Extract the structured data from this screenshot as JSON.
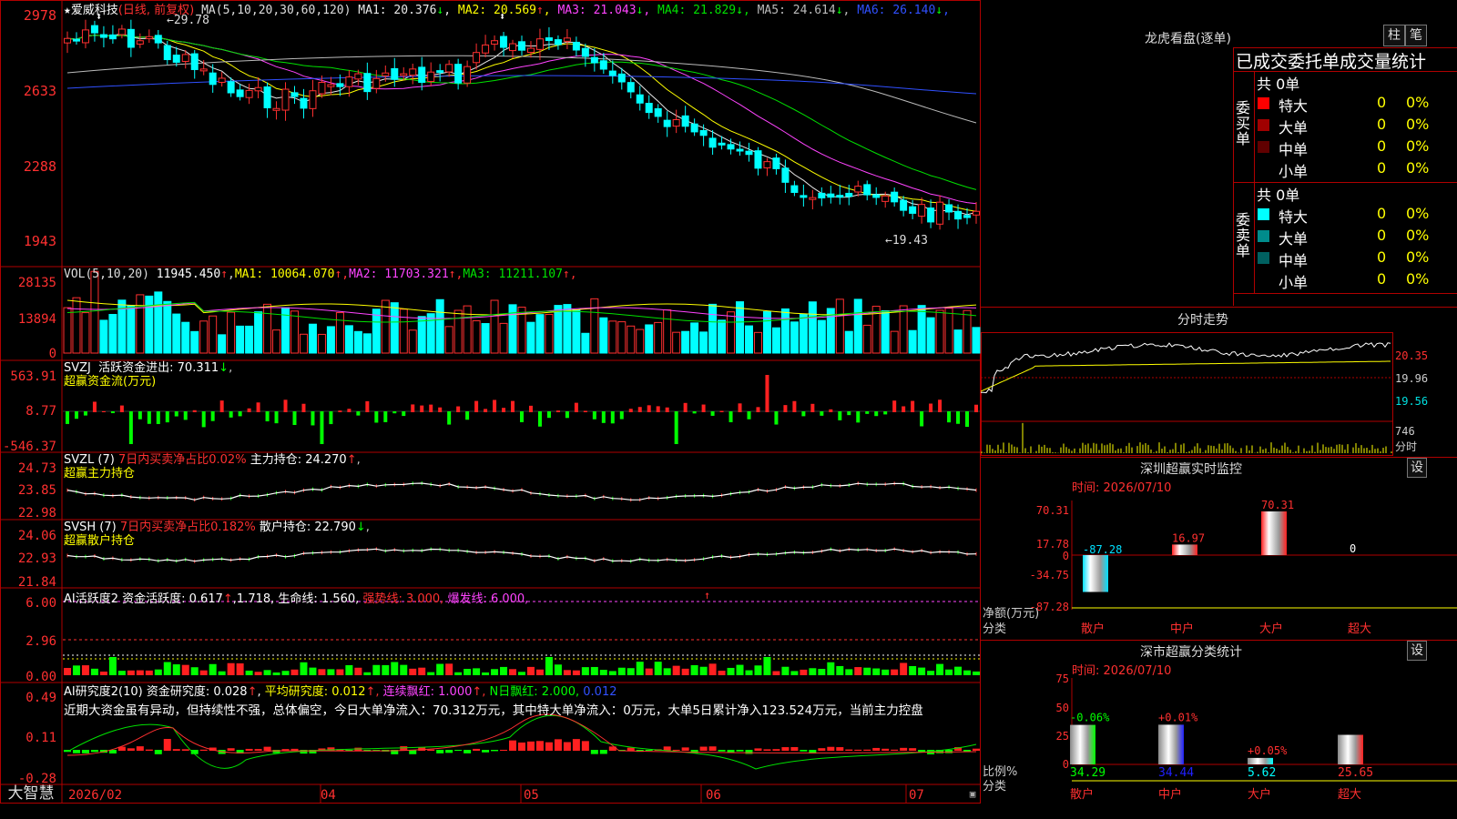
{
  "app": {
    "name": "大智慧",
    "logo": "大智慧"
  },
  "chart_header": {
    "stock": "爱威科技",
    "period": "(日线, 前复权)",
    "ma_params": "MA(5,10,20,30,60,120)",
    "ma": [
      {
        "label": "MA1:",
        "value": "20.376",
        "arrow": "↓",
        "color": "#e8e8e8"
      },
      {
        "label": "MA2:",
        "value": "20.569",
        "arrow": "↑",
        "color": "#ffff00"
      },
      {
        "label": "MA3:",
        "value": "21.043",
        "arrow": "↓",
        "color": "#ff44ff"
      },
      {
        "label": "MA4:",
        "value": "21.829",
        "arrow": "↓",
        "color": "#00e000"
      },
      {
        "label": "MA5:",
        "value": "24.614",
        "arrow": "↓",
        "color": "#bbbbbb"
      },
      {
        "label": "MA6:",
        "value": "26.140",
        "arrow": "↓",
        "color": "#3050ff"
      }
    ],
    "high_mark": "29.78",
    "low_mark": "19.43"
  },
  "price_axis": [
    "2978",
    "2633",
    "2288",
    "1943"
  ],
  "volume": {
    "header": "VOL(5,10,20)",
    "value": "11945.450",
    "value_arrow": "↑",
    "ma": [
      {
        "label": "MA1:",
        "value": "10064.070",
        "arrow": "↑",
        "color": "#ffff00"
      },
      {
        "label": "MA2:",
        "value": "11703.321",
        "arrow": "↑",
        "color": "#ff44ff"
      },
      {
        "label": "MA3:",
        "value": "11211.107",
        "arrow": "↑",
        "color": "#00e000"
      }
    ],
    "axis": [
      "28135",
      "13894",
      "0"
    ]
  },
  "svzj": {
    "line1": "SVZJ  活跃资金进出: 70.311",
    "arrow": "↓",
    "line2": "超赢资金流(万元)",
    "axis": [
      "563.91",
      "8.77",
      "-546.37"
    ]
  },
  "svzl": {
    "name": "SVZL (7)",
    "desc": "7日内买卖净占比0.02%",
    "label": "主力持仓: 24.270",
    "arrow": "↑",
    "line2": "超赢主力持仓",
    "axis": [
      "24.73",
      "23.85",
      "22.98"
    ]
  },
  "svsh": {
    "name": "SVSH (7)",
    "desc": "7日内买卖净占比0.182%",
    "label": "散户持仓: 22.790",
    "arrow": "↓",
    "line2": "超赢散户持仓",
    "axis": [
      "24.06",
      "22.93",
      "21.84"
    ]
  },
  "ai_active": {
    "name": "AI活跃度2",
    "label": "资金活跃度: 0.617",
    "arrow": "↑",
    "v2": "1.718,",
    "life": "生命线: 1.560,",
    "strong": "强势线: 3.000,",
    "burst": "爆发线: 6.000,",
    "axis": [
      "6.00",
      "2.96",
      "0.00"
    ]
  },
  "ai_research": {
    "name": "AI研究度2(10)",
    "label": "资金研究度: 0.028",
    "arrow": "↑",
    "avg": "平均研究度: 0.012",
    "cont": "连续飘红: 1.000",
    "nday": "N日飘红: 2.000,",
    "last": "0.012",
    "comment": "近期大资金虽有异动，但持续性不强，总体偏空，今日大单净流入：70.312万元，其中特大单净流入：0万元，大单5日累计净入123.524万元，当前主力控盘",
    "axis": [
      "0.49",
      "0.11",
      "-0.28"
    ]
  },
  "xaxis": [
    "2026/02",
    "04",
    "05",
    "06",
    "07"
  ],
  "dragon": {
    "title": "龙虎看盘(逐单)",
    "btn_bar": "柱",
    "btn_pen": "笔",
    "subtitle": "已成交委托单成交量统计",
    "buy": {
      "side": "委买单",
      "total": "共 0单",
      "rows": [
        {
          "label": "特大",
          "count": "0",
          "pct": "0%",
          "color": "#ff0000"
        },
        {
          "label": "大单",
          "count": "0",
          "pct": "0%",
          "color": "#a00000"
        },
        {
          "label": "中单",
          "count": "0",
          "pct": "0%",
          "color": "#600000"
        },
        {
          "label": "小单",
          "count": "0",
          "pct": "0%",
          "color": "#000000"
        }
      ]
    },
    "sell": {
      "side": "委卖单",
      "total": "共 0单",
      "rows": [
        {
          "label": "特大",
          "count": "0",
          "pct": "0%",
          "color": "#00ffff"
        },
        {
          "label": "大单",
          "count": "0",
          "pct": "0%",
          "color": "#008c8c"
        },
        {
          "label": "中单",
          "count": "0",
          "pct": "0%",
          "color": "#006060"
        },
        {
          "label": "小单",
          "count": "0",
          "pct": "0%",
          "color": "#000000"
        }
      ]
    }
  },
  "intraday": {
    "title": "分时走势",
    "axis": [
      "20.35",
      "19.96",
      "19.56",
      "746",
      "分时"
    ]
  },
  "monitor": {
    "title": "深圳超赢实时监控",
    "btn": "设",
    "date": "时间: 2026/07/10",
    "axis": [
      "70.31",
      "17.78",
      "0",
      "-34.75",
      "-87.28"
    ],
    "ylabel": "净额(万元)",
    "xlabel": "分类",
    "bars": [
      {
        "cat": "散户",
        "value": "-87.28",
        "color": "#00e0ff"
      },
      {
        "cat": "中户",
        "value": "16.97",
        "color": "#ff2020"
      },
      {
        "cat": "大户",
        "value": "70.31",
        "color": "#ff2020"
      },
      {
        "cat": "超大",
        "value": "0",
        "color": "#ff2020"
      }
    ]
  },
  "classify": {
    "title": "深市超赢分类统计",
    "btn": "设",
    "date": "时间: 2026/07/10",
    "axis": [
      "75",
      "50",
      "25",
      "0"
    ],
    "ylabel": "比例%",
    "xlabel": "分类",
    "bars": [
      {
        "cat": "散户",
        "value": "34.29",
        "change": "-0.06%",
        "color": "#00ff00"
      },
      {
        "cat": "中户",
        "value": "34.44",
        "change": "+0.01%",
        "color": "#2020ff"
      },
      {
        "cat": "大户",
        "value": "5.62",
        "change": "+0.05%",
        "color": "#00ffff"
      },
      {
        "cat": "超大",
        "value": "25.65",
        "change": "",
        "color": "#ff2020"
      }
    ]
  }
}
